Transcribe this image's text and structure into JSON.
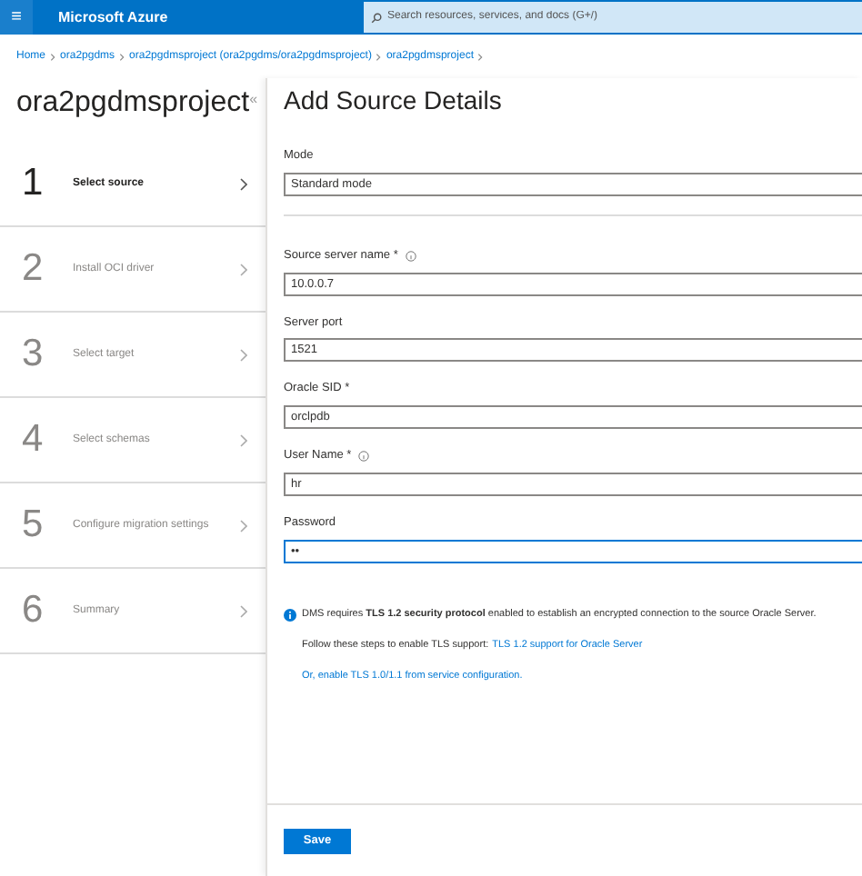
{
  "top_bar": {
    "menu_icon": "≡",
    "brand": "Microsoft Azure",
    "search": {
      "placeholder": "Search resources, services, and docs (G+/)"
    }
  },
  "breadcrumbs": [
    "Home",
    "ora2pgdms",
    "ora2pgdmsproject (ora2pgdms/ora2pgdmsproject)",
    "ora2pgdmsproject"
  ],
  "sidebar": {
    "title": "ora2pgdmsproject",
    "collapse": "«",
    "steps": [
      {
        "number": "1",
        "label": "Select source",
        "selected": true
      },
      {
        "number": "2",
        "label": "Install OCI driver",
        "selected": false
      },
      {
        "number": "3",
        "label": "Select target",
        "selected": false
      },
      {
        "number": "4",
        "label": "Select schemas",
        "selected": false
      },
      {
        "number": "5",
        "label": "Configure migration settings",
        "selected": false
      },
      {
        "number": "6",
        "label": "Summary",
        "selected": false
      }
    ]
  },
  "panel": {
    "title": "Add Source Details",
    "fields": [
      {
        "kind": "input",
        "label": "Mode",
        "value": "Standard mode",
        "focused": false
      },
      {
        "kind": "divider"
      },
      {
        "kind": "input_with_info",
        "label": "Source server name *",
        "value": "10.0.0.7",
        "focused": false
      },
      {
        "kind": "input",
        "label": "Server port",
        "value": "1521",
        "focused": false
      },
      {
        "kind": "input",
        "label": "Oracle SID *",
        "value": "orclpdb",
        "focused": false
      },
      {
        "kind": "input_with_info",
        "label": "User Name *",
        "value": "hr",
        "focused": false
      },
      {
        "kind": "input",
        "label": "Password",
        "value": "••",
        "focused": true
      }
    ],
    "notice": {
      "text": "DMS requires **TLS 1.2 security protocol** enabled to establish an encrypted connection to the source Oracle Server.",
      "steps_text": "Follow these steps to enable TLS support:",
      "steps_link": "TLS 1.2 support for Oracle Server",
      "config_link": "Or, enable TLS 1.0/1.1 from service configuration."
    },
    "save_button": "Save"
  }
}
